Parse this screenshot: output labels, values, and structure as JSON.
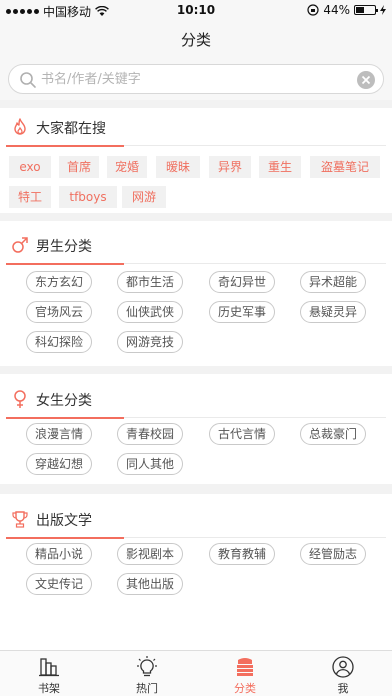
{
  "status_bar": {
    "carrier": "中国移动",
    "time": "10:10",
    "battery": "44%",
    "battery_level": 0.44
  },
  "header": {
    "title": "分类"
  },
  "search": {
    "placeholder": "书名/作者/关键字",
    "value": ""
  },
  "sections": {
    "hot": {
      "title": "大家都在搜",
      "icon": "flame-icon",
      "tags": [
        "exo",
        "首席",
        "宠婚",
        "暧昧",
        "异界",
        "重生",
        "盗墓笔记",
        "特工",
        "tfboys",
        "网游"
      ]
    },
    "male": {
      "title": "男生分类",
      "icon": "male-icon",
      "tags": [
        "东方玄幻",
        "都市生活",
        "奇幻异世",
        "异术超能",
        "官场风云",
        "仙侠武侠",
        "历史军事",
        "悬疑灵异",
        "科幻探险",
        "网游竞技"
      ]
    },
    "female": {
      "title": "女生分类",
      "icon": "female-icon",
      "tags": [
        "浪漫言情",
        "青春校园",
        "古代言情",
        "总裁豪门",
        "穿越幻想",
        "同人其他"
      ]
    },
    "publish": {
      "title": "出版文学",
      "icon": "trophy-icon",
      "tags": [
        "精品小说",
        "影视剧本",
        "教育教辅",
        "经管励志",
        "文史传记",
        "其他出版"
      ]
    }
  },
  "accent_color": "#f36e5e",
  "tab_bar": {
    "tabs": [
      {
        "label": "书架",
        "icon": "bookshelf-icon"
      },
      {
        "label": "热门",
        "icon": "lightbulb-icon"
      },
      {
        "label": "分类",
        "icon": "category-books-icon",
        "active": true
      },
      {
        "label": "我",
        "icon": "person-icon"
      }
    ]
  }
}
